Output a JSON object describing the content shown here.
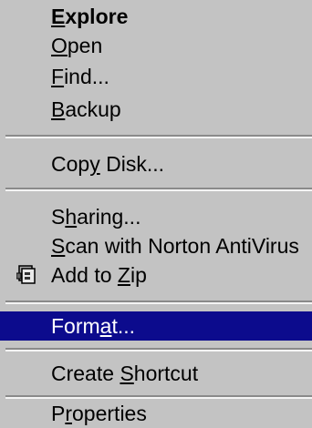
{
  "menu": {
    "items": [
      {
        "pre": "",
        "key": "E",
        "post": "xplore"
      },
      {
        "pre": "",
        "key": "O",
        "post": "pen"
      },
      {
        "pre": "",
        "key": "F",
        "post": "ind..."
      },
      {
        "pre": "",
        "key": "B",
        "post": "ackup"
      },
      {
        "pre": "Cop",
        "key": "y",
        "post": " Disk..."
      },
      {
        "pre": "S",
        "key": "h",
        "post": "aring..."
      },
      {
        "pre": "",
        "key": "S",
        "post": "can with Norton AntiVirus"
      },
      {
        "pre": "Add to ",
        "key": "Z",
        "post": "ip"
      },
      {
        "pre": "Form",
        "key": "a",
        "post": "t..."
      },
      {
        "pre": "Create ",
        "key": "S",
        "post": "hortcut"
      },
      {
        "pre": "P",
        "key": "r",
        "post": "operties"
      }
    ],
    "selected_index": 8,
    "selected_color": "#0c0b8d",
    "default_item": "Explore",
    "icons": {
      "add_to_zip": "winzip-icon"
    }
  }
}
